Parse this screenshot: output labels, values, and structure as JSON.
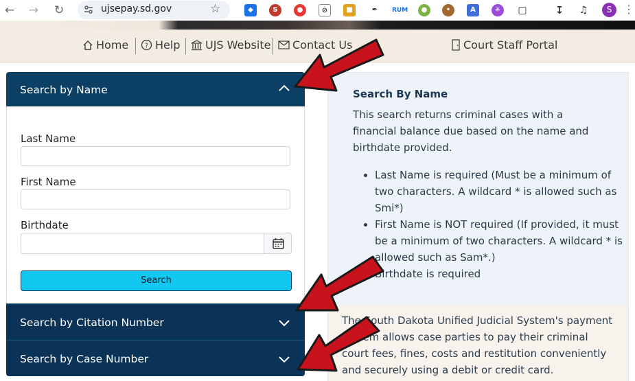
{
  "browser": {
    "url": "ujsepay.sd.gov",
    "profile_initial": "S",
    "icons": [
      "back-icon",
      "forward-icon",
      "reload-icon",
      "site-settings-icon",
      "bookmark-star-icon",
      "download-icon",
      "tab-search-icon",
      "extensions-icon",
      "menu-icon"
    ]
  },
  "nav": {
    "home": "Home",
    "help": "Help",
    "ujs_website": "UJS Website",
    "contact_us": "Contact Us",
    "court_staff_portal": "Court Staff Portal"
  },
  "search_by_name": {
    "header": "Search by Name",
    "last_name_label": "Last Name",
    "first_name_label": "First Name",
    "birthdate_label": "Birthdate",
    "last_name_value": "",
    "first_name_value": "",
    "birthdate_value": "",
    "search_button": "Search"
  },
  "search_by_citation": {
    "header": "Search by Citation Number"
  },
  "search_by_case": {
    "header": "Search by Case Number"
  },
  "info": {
    "title": "Search By Name",
    "intro": "This search returns criminal cases with a financial balance due based on the name and birthdate provided.",
    "bullets": [
      "Last Name is required (Must be a minimum of two characters. A wildcard * is allowed such as Smi*)",
      "First Name is NOT required (If provided, it must be a minimum of two characters. A wildcard",
      "* is allowed such as Sam*.)",
      "Birthdate is required"
    ]
  },
  "about": {
    "text": "The South Dakota Unified Judicial System's payment system allows case parties to pay their criminal court fees, fines, costs and restitution conveniently and securely using a debit or credit card."
  },
  "colors": {
    "header_blue": "#0b3f63",
    "search_button": "#12c7f0",
    "info_bg": "#eef3fa",
    "arrow_red": "#c8131c"
  }
}
